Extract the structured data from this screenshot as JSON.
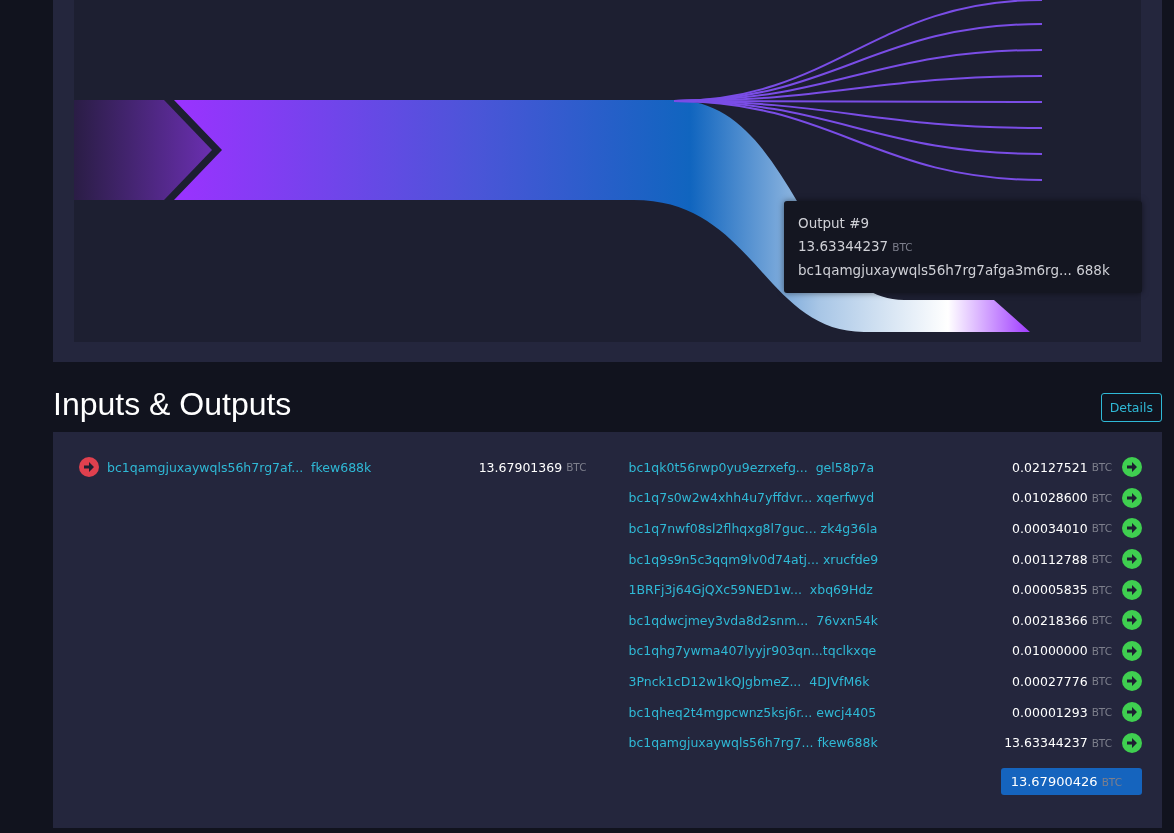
{
  "tooltip": {
    "title": "Output #9",
    "amount": "13.63344237",
    "unit": "BTC",
    "address": "bc1qamgjuxaywqls56h7rg7afga3m6rg... 688k"
  },
  "section": {
    "title": "Inputs & Outputs",
    "details_button": "Details"
  },
  "inputs": [
    {
      "address": "bc1qamgjuxaywqls56h7rg7af...  fkew688k",
      "amount": "13.67901369",
      "unit": "BTC"
    }
  ],
  "outputs": [
    {
      "address": "bc1qk0t56rwp0yu9ezrxefg...  gel58p7a",
      "amount": "0.02127521",
      "unit": "BTC"
    },
    {
      "address": "bc1q7s0w2w4xhh4u7yffdvr... xqerfwyd",
      "amount": "0.01028600",
      "unit": "BTC"
    },
    {
      "address": "bc1q7nwf08sl2flhqxg8l7guc... zk4g36la",
      "amount": "0.00034010",
      "unit": "BTC"
    },
    {
      "address": "bc1q9s9n5c3qqm9lv0d74atj... xrucfde9",
      "amount": "0.00112788",
      "unit": "BTC"
    },
    {
      "address": "1BRFj3j64GjQXc59NED1w...  xbq69Hdz",
      "amount": "0.00005835",
      "unit": "BTC"
    },
    {
      "address": "bc1qdwcjmey3vda8d2snm...  76vxn54k",
      "amount": "0.00218366",
      "unit": "BTC"
    },
    {
      "address": "bc1qhg7ywma407lyyjr903qn...tqclkxqe",
      "amount": "0.01000000",
      "unit": "BTC"
    },
    {
      "address": "3Pnck1cD12w1kQJgbmeZ...  4DJVfM6k",
      "amount": "0.00027776",
      "unit": "BTC"
    },
    {
      "address": "bc1qheq2t4mgpcwnz5ksj6r... ewcj4405",
      "amount": "0.00001293",
      "unit": "BTC"
    },
    {
      "address": "bc1qamgjuxaywqls56h7rg7... fkew688k",
      "amount": "13.63344237",
      "unit": "BTC"
    }
  ],
  "total": {
    "amount": "13.67900426",
    "unit": "BTC"
  }
}
